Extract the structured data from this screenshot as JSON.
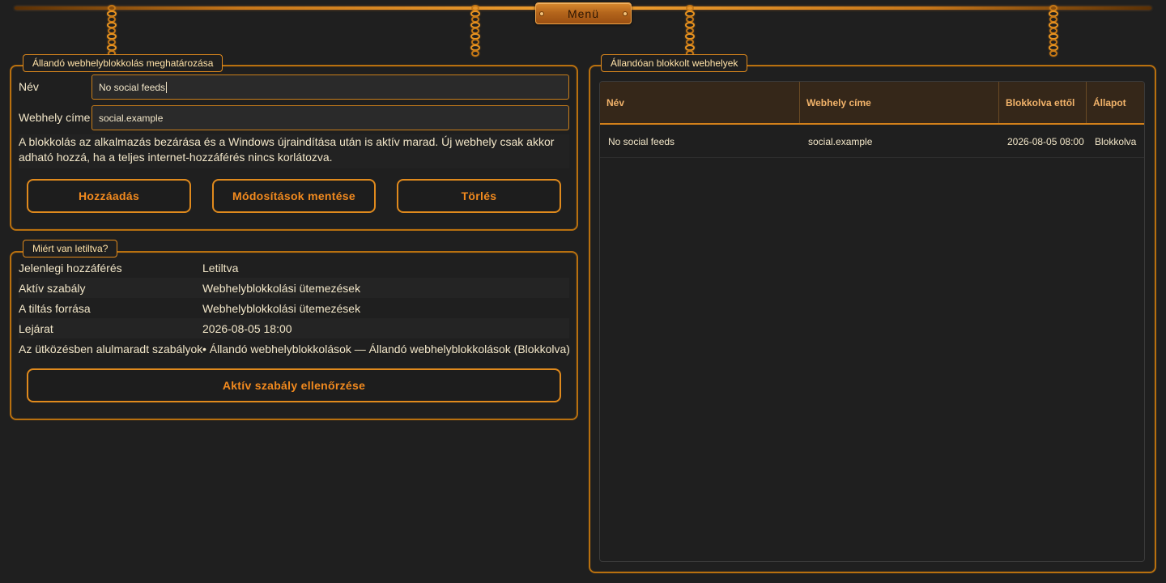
{
  "menu": {
    "label": "Menü"
  },
  "define_group": {
    "title": "Állandó webhelyblokkolás meghatározása",
    "name_label": "Név",
    "name_value": "No social feeds",
    "url_label": "Webhely címe",
    "url_value": "social.example",
    "note": "A blokkolás az alkalmazás bezárása és a Windows újraindítása után is aktív marad. Új webhely csak akkor adható hozzá, ha a teljes internet-hozzáférés nincs korlátozva.",
    "add_label": "Hozzáadás",
    "save_label": "Módosítások mentése",
    "delete_label": "Törlés"
  },
  "why_group": {
    "title": "Miért van letiltva?",
    "rows": [
      {
        "key": "Jelenlegi hozzáférés",
        "value": "Letiltva"
      },
      {
        "key": "Aktív szabály",
        "value": "Webhelyblokkolási ütemezések"
      },
      {
        "key": "A tiltás forrása",
        "value": "Webhelyblokkolási ütemezések"
      },
      {
        "key": "Lejárat",
        "value": "2026-08-05 18:00"
      },
      {
        "key": "Az ütközésben alulmaradt szabályok",
        "value": "• Állandó webhelyblokkolások — Állandó webhelyblokkolások (Blokkolva)"
      }
    ],
    "check_label": "Aktív szabály ellenőrzése"
  },
  "blocked_group": {
    "title": "Állandóan blokkolt webhelyek",
    "columns": [
      "Név",
      "Webhely címe",
      "Blokkolva ettől",
      "Állapot"
    ],
    "rows": [
      {
        "name": "No social feeds",
        "url": "social.example",
        "since": "2026-08-05 08:00",
        "status": "Blokkolva"
      }
    ]
  },
  "colors": {
    "accent": "#e08a1d",
    "background": "#1f1f1f",
    "text": "#f2e6c8",
    "header_bg": "#352719"
  }
}
